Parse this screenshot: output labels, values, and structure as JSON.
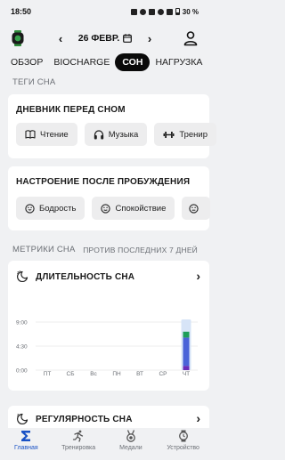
{
  "status_bar": {
    "time": "18:50",
    "battery": "30 %"
  },
  "header": {
    "date": "26 ФЕВР."
  },
  "tabs": [
    {
      "label": "ОБЗОР",
      "active": false
    },
    {
      "label": "BIOCHARGE",
      "active": false
    },
    {
      "label": "СОН",
      "active": true
    },
    {
      "label": "НАГРУЗКА",
      "active": false
    }
  ],
  "sleep_tags": {
    "section_label": "ТЕГИ СНА",
    "diary": {
      "title": "ДНЕВНИК ПЕРЕД СНОМ",
      "chips": [
        {
          "label": "Чтение",
          "icon": "book-icon"
        },
        {
          "label": "Музыка",
          "icon": "headphones-icon"
        },
        {
          "label": "Тренир",
          "icon": "dumbbell-icon"
        }
      ]
    },
    "mood": {
      "title": "НАСТРОЕНИЕ ПОСЛЕ ПРОБУЖДЕНИЯ",
      "chips": [
        {
          "label": "Бодрость",
          "icon": "happy-face-icon"
        },
        {
          "label": "Спокойствие",
          "icon": "calm-face-icon"
        },
        {
          "label": "",
          "icon": "face-icon"
        }
      ]
    }
  },
  "metrics": {
    "section_label": "МЕТРИКИ СНА",
    "comparison_label": "ПРОТИВ ПОСЛЕДНИХ 7 ДНЕЙ",
    "duration_card": {
      "title": "ДЛИТЕЛЬНОСТЬ СНА"
    },
    "regularity_card": {
      "title": "РЕГУЛЯРНОСТЬ СНА"
    }
  },
  "chart_data": {
    "type": "bar",
    "stacked": true,
    "categories": [
      "ПТ",
      "СБ",
      "Вс",
      "ПН",
      "ВТ",
      "СР",
      "ЧТ"
    ],
    "y_tick_labels": [
      "9:00",
      "4:30",
      "0:00"
    ],
    "ylim_hours": [
      0,
      9
    ],
    "series": [
      {
        "color": "#6a2cb8",
        "values": [
          0,
          0,
          0,
          0,
          0,
          0,
          0.8
        ]
      },
      {
        "color": "#4a63d8",
        "values": [
          0,
          0,
          0,
          0,
          0,
          0,
          5.3
        ]
      },
      {
        "color": "#1e9e5a",
        "values": [
          0,
          0,
          0,
          0,
          0,
          0,
          1.1
        ]
      }
    ],
    "highlight_category": "ЧТ",
    "highlight_color": "#d7e4f7",
    "grid": true
  },
  "bottom_nav": [
    {
      "label": "Главная",
      "icon": "sigma-icon",
      "active": true
    },
    {
      "label": "Тренировка",
      "icon": "runner-icon",
      "active": false
    },
    {
      "label": "Медали",
      "icon": "medal-icon",
      "active": false
    },
    {
      "label": "Устройство",
      "icon": "watch-icon",
      "active": false
    }
  ],
  "colors": {
    "accent": "#1a52c5",
    "background": "#f0f1f3",
    "card": "#ffffff"
  }
}
